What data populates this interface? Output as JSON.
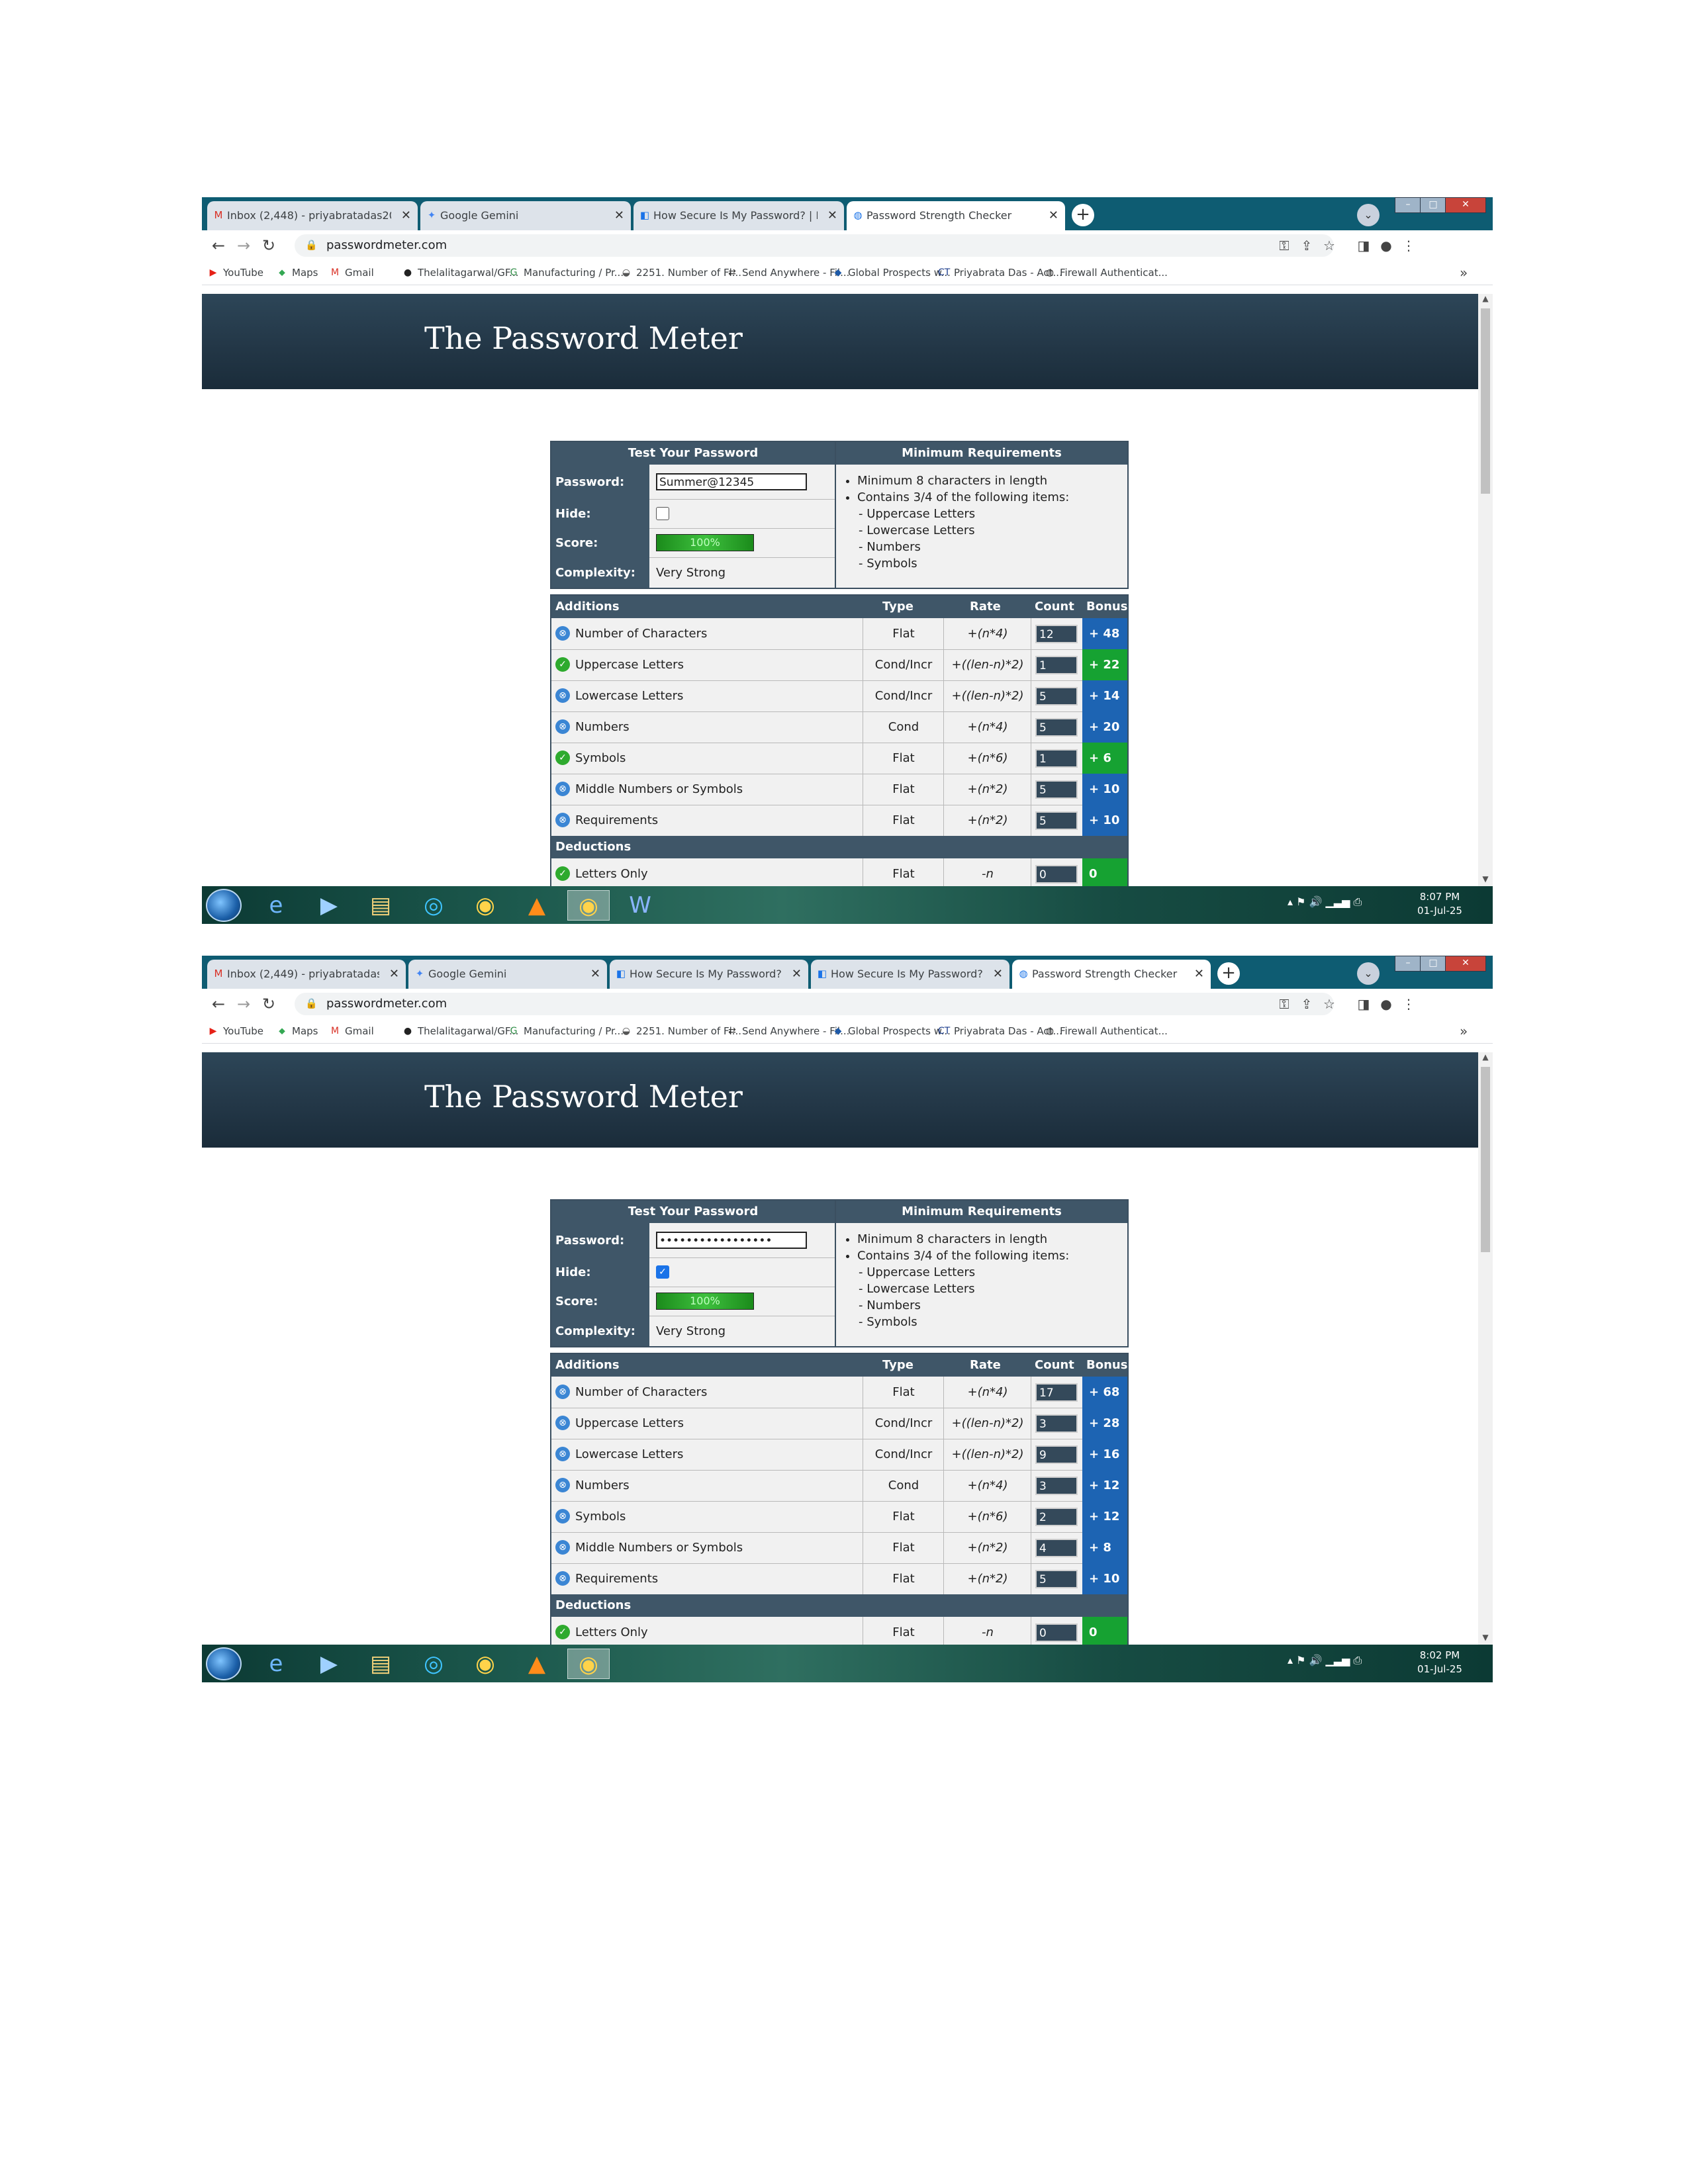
{
  "shots": [
    {
      "tabs": [
        {
          "title": "Inbox (2,448) - priyabratadas200:",
          "icon": "gmail-icon"
        },
        {
          "title": "Google Gemini",
          "icon": "gemini-icon"
        },
        {
          "title": "How Secure Is My Password? | Pa",
          "icon": "site-icon"
        },
        {
          "title": "Password Strength Checker",
          "icon": "globe-icon"
        }
      ],
      "url": "passwordmeter.com",
      "bookmarks": [
        "YouTube",
        "Maps",
        "Gmail",
        "Thelalitagarwal/GF...",
        "Manufacturing / Pr...",
        "2251. Number of Fl...",
        "Send Anywhere - Fil...",
        "Global Prospects w...",
        "Priyabrata Das - Act...",
        "Firewall Authenticat..."
      ],
      "site_title": "The Password Meter",
      "test_header": "Test Your Password",
      "req_header": "Minimum Requirements",
      "password_label": "Password:",
      "password_value": "Summer@12345",
      "hide_label": "Hide:",
      "hide_checked": false,
      "score_label": "Score:",
      "score_value": "100%",
      "complexity_label": "Complexity:",
      "complexity_value": "Very Strong",
      "requirements": [
        "Minimum 8 characters in length",
        "Contains 3/4 of the following items:"
      ],
      "sub_requirements": [
        "- Uppercase Letters",
        "- Lowercase Letters",
        "- Numbers",
        "- Symbols"
      ],
      "additions_headers": {
        "label": "Additions",
        "type": "Type",
        "rate": "Rate",
        "count": "Count",
        "bonus": "Bonus"
      },
      "rows": [
        {
          "name": "Number of Characters",
          "type": "Flat",
          "rate": "+(n*4)",
          "count": "12",
          "bonus": "+ 48",
          "status": "blue",
          "bonus_color": "blue"
        },
        {
          "name": "Uppercase Letters",
          "type": "Cond/Incr",
          "rate": "+((len-n)*2)",
          "count": "1",
          "bonus": "+ 22",
          "status": "green",
          "bonus_color": "green"
        },
        {
          "name": "Lowercase Letters",
          "type": "Cond/Incr",
          "rate": "+((len-n)*2)",
          "count": "5",
          "bonus": "+ 14",
          "status": "blue",
          "bonus_color": "blue"
        },
        {
          "name": "Numbers",
          "type": "Cond",
          "rate": "+(n*4)",
          "count": "5",
          "bonus": "+ 20",
          "status": "blue",
          "bonus_color": "blue"
        },
        {
          "name": "Symbols",
          "type": "Flat",
          "rate": "+(n*6)",
          "count": "1",
          "bonus": "+ 6",
          "status": "green",
          "bonus_color": "green"
        },
        {
          "name": "Middle Numbers or Symbols",
          "type": "Flat",
          "rate": "+(n*2)",
          "count": "5",
          "bonus": "+ 10",
          "status": "blue",
          "bonus_color": "blue"
        },
        {
          "name": "Requirements",
          "type": "Flat",
          "rate": "+(n*2)",
          "count": "5",
          "bonus": "+ 10",
          "status": "blue",
          "bonus_color": "blue"
        }
      ],
      "deductions_label": "Deductions",
      "deduction_row": {
        "name": "Letters Only",
        "type": "Flat",
        "rate": "-n",
        "count": "0",
        "bonus": "0"
      },
      "clock_time": "8:07 PM",
      "clock_date": "01-Jul-25"
    },
    {
      "tabs": [
        {
          "title": "Inbox (2,449) - priyabratadas2(",
          "icon": "gmail-icon"
        },
        {
          "title": "Google Gemini",
          "icon": "gemini-icon"
        },
        {
          "title": "How Secure Is My Password?",
          "icon": "site-icon"
        },
        {
          "title": "How Secure Is My Password? |",
          "icon": "site-icon"
        },
        {
          "title": "Password Strength Checker",
          "icon": "globe-icon"
        }
      ],
      "url": "passwordmeter.com",
      "bookmarks": [
        "YouTube",
        "Maps",
        "Gmail",
        "Thelalitagarwal/GF...",
        "Manufacturing / Pr...",
        "2251. Number of Fl...",
        "Send Anywhere - Fil...",
        "Global Prospects w...",
        "Priyabrata Das - Act...",
        "Firewall Authenticat..."
      ],
      "site_title": "The Password Meter",
      "test_header": "Test Your Password",
      "req_header": "Minimum Requirements",
      "password_label": "Password:",
      "password_value": "•••••••••••••••••",
      "hide_label": "Hide:",
      "hide_checked": true,
      "score_label": "Score:",
      "score_value": "100%",
      "complexity_label": "Complexity:",
      "complexity_value": "Very Strong",
      "requirements": [
        "Minimum 8 characters in length",
        "Contains 3/4 of the following items:"
      ],
      "sub_requirements": [
        "- Uppercase Letters",
        "- Lowercase Letters",
        "- Numbers",
        "- Symbols"
      ],
      "additions_headers": {
        "label": "Additions",
        "type": "Type",
        "rate": "Rate",
        "count": "Count",
        "bonus": "Bonus"
      },
      "rows": [
        {
          "name": "Number of Characters",
          "type": "Flat",
          "rate": "+(n*4)",
          "count": "17",
          "bonus": "+ 68",
          "status": "blue",
          "bonus_color": "blue"
        },
        {
          "name": "Uppercase Letters",
          "type": "Cond/Incr",
          "rate": "+((len-n)*2)",
          "count": "3",
          "bonus": "+ 28",
          "status": "blue",
          "bonus_color": "blue"
        },
        {
          "name": "Lowercase Letters",
          "type": "Cond/Incr",
          "rate": "+((len-n)*2)",
          "count": "9",
          "bonus": "+ 16",
          "status": "blue",
          "bonus_color": "blue"
        },
        {
          "name": "Numbers",
          "type": "Cond",
          "rate": "+(n*4)",
          "count": "3",
          "bonus": "+ 12",
          "status": "blue",
          "bonus_color": "blue"
        },
        {
          "name": "Symbols",
          "type": "Flat",
          "rate": "+(n*6)",
          "count": "2",
          "bonus": "+ 12",
          "status": "blue",
          "bonus_color": "blue"
        },
        {
          "name": "Middle Numbers or Symbols",
          "type": "Flat",
          "rate": "+(n*2)",
          "count": "4",
          "bonus": "+ 8",
          "status": "blue",
          "bonus_color": "blue"
        },
        {
          "name": "Requirements",
          "type": "Flat",
          "rate": "+(n*2)",
          "count": "5",
          "bonus": "+ 10",
          "status": "blue",
          "bonus_color": "blue"
        }
      ],
      "deductions_label": "Deductions",
      "deduction_row": {
        "name": "Letters Only",
        "type": "Flat",
        "rate": "-n",
        "count": "0",
        "bonus": "0"
      },
      "clock_time": "8:02 PM",
      "clock_date": "01-Jul-25"
    }
  ]
}
